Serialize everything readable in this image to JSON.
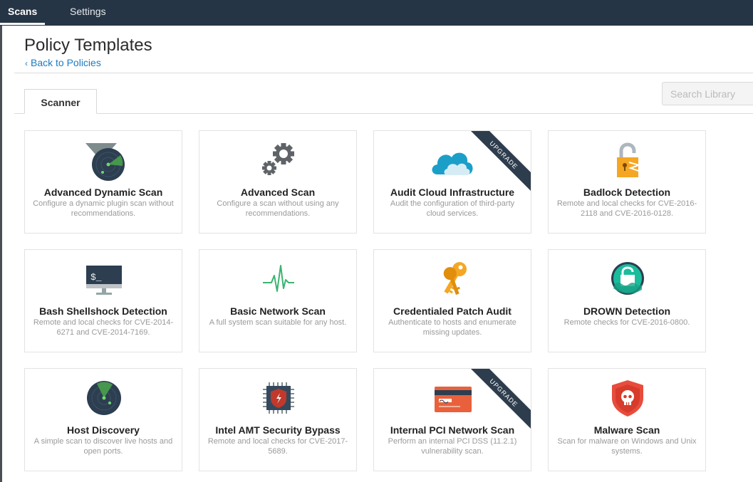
{
  "nav": {
    "scans": "Scans",
    "settings": "Settings"
  },
  "page": {
    "title": "Policy Templates",
    "back_chevron": "‹",
    "back_link": "Back to Policies"
  },
  "tabs": {
    "scanner": "Scanner"
  },
  "search": {
    "placeholder": "Search Library"
  },
  "cards": [
    {
      "title": "Advanced Dynamic Scan",
      "desc": "Configure a dynamic plugin scan without recommendations.",
      "icon": "funnel-radar-icon"
    },
    {
      "title": "Advanced Scan",
      "desc": "Configure a scan without using any recommendations.",
      "icon": "gears-icon"
    },
    {
      "title": "Audit Cloud Infrastructure",
      "desc": "Audit the configuration of third-party cloud services.",
      "icon": "cloud-icon",
      "ribbon": "UPGRADE"
    },
    {
      "title": "Badlock Detection",
      "desc": "Remote and local checks for CVE-2016-2118 and CVE-2016-0128.",
      "icon": "broken-lock-icon"
    },
    {
      "title": "Bash Shellshock Detection",
      "desc": "Remote and local checks for CVE-2014-6271 and CVE-2014-7169.",
      "icon": "terminal-monitor-icon",
      "screen_text": "$_"
    },
    {
      "title": "Basic Network Scan",
      "desc": "A full system scan suitable for any host.",
      "icon": "heartbeat-icon"
    },
    {
      "title": "Credentialed Patch Audit",
      "desc": "Authenticate to hosts and enumerate missing updates.",
      "icon": "keys-icon"
    },
    {
      "title": "DROWN Detection",
      "desc": "Remote checks for CVE-2016-0800.",
      "icon": "drowning-lock-icon"
    },
    {
      "title": "Host Discovery",
      "desc": "A simple scan to discover live hosts and open ports.",
      "icon": "radar-icon"
    },
    {
      "title": "Intel AMT Security Bypass",
      "desc": "Remote and local checks for CVE-2017-5689.",
      "icon": "chip-shield-icon"
    },
    {
      "title": "Internal PCI Network Scan",
      "desc": "Perform an internal PCI DSS (11.2.1) vulnerability scan.",
      "icon": "credit-card-icon",
      "ribbon": "UPGRADE"
    },
    {
      "title": "Malware Scan",
      "desc": "Scan for malware on Windows and Unix systems.",
      "icon": "skull-shield-icon"
    }
  ],
  "colors": {
    "nav": "#263545",
    "link": "#1c7bc1",
    "ribbon": "#2e3d4d"
  }
}
